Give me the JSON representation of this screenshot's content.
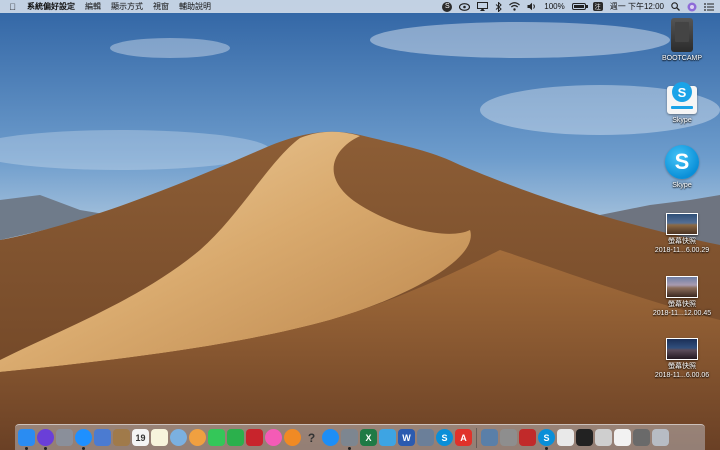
{
  "menubar": {
    "apple_icon": "apple-icon",
    "app_name": "系統偏好設定",
    "menus": [
      "編輯",
      "顯示方式",
      "視窗",
      "輔助說明"
    ],
    "battery_percent": "100%",
    "battery_level": 1.0,
    "ime": "注",
    "clock": "週一 下午12:00"
  },
  "desktop_icons": [
    {
      "label": "BOOTCAMP",
      "icon": "drive-icon"
    },
    {
      "label": "Skype",
      "icon": "skype-installer-icon"
    },
    {
      "label": "Skype",
      "icon": "skype-app-icon"
    },
    {
      "label_line1": "螢幕快照",
      "label_line2": "2018-11...6.00.29",
      "icon": "screenshot-thumbnail-icon"
    },
    {
      "label_line1": "螢幕快照",
      "label_line2": "2018-11...12.00.45",
      "icon": "screenshot-thumbnail-icon"
    },
    {
      "label_line1": "螢幕快照",
      "label_line2": "2018-11...6.00.06",
      "icon": "screenshot-thumbnail-icon"
    }
  ],
  "dock": {
    "apps": [
      {
        "icon": "finder-icon",
        "color": "#2a8cf2",
        "running": true
      },
      {
        "icon": "siri-icon",
        "color": "#6a3fd8",
        "running": true
      },
      {
        "icon": "launchpad-icon",
        "color": "#8a8f9a",
        "running": false
      },
      {
        "icon": "safari-icon",
        "color": "#1e90ff",
        "running": true
      },
      {
        "icon": "preview-icon",
        "color": "#4b7bd1",
        "running": false
      },
      {
        "icon": "notebook-icon",
        "color": "#a07a4a",
        "running": false
      },
      {
        "icon": "calendar-icon",
        "color": "#f4f4f4",
        "glyph": "19",
        "running": false
      },
      {
        "icon": "notes-icon",
        "color": "#f7f4dc",
        "running": false
      },
      {
        "icon": "preview-photos-icon",
        "color": "#7bb0e0",
        "running": false
      },
      {
        "icon": "photos-icon",
        "color": "#f0a040",
        "running": false
      },
      {
        "icon": "messages-icon",
        "color": "#34c759",
        "running": false
      },
      {
        "icon": "facetime-icon",
        "color": "#2bb04c",
        "running": false
      },
      {
        "icon": "photo-booth-icon",
        "color": "#c8242c",
        "running": false
      },
      {
        "icon": "itunes-icon",
        "color": "#f45bb6",
        "running": false
      },
      {
        "icon": "ibooks-icon",
        "color": "#f08a24",
        "running": false
      },
      {
        "icon": "help-icon",
        "color": "transparent",
        "glyph": "?",
        "running": false
      },
      {
        "icon": "app-store-icon",
        "color": "#1e8ef5",
        "running": false
      },
      {
        "icon": "system-preferences-icon",
        "color": "#7d8690",
        "running": true
      },
      {
        "icon": "excel-icon",
        "color": "#1f7a45",
        "glyph": "X",
        "running": false
      },
      {
        "icon": "teams-people-icon",
        "color": "#3da4e3",
        "running": false
      },
      {
        "icon": "word-icon",
        "color": "#2b5bb0",
        "glyph": "W",
        "running": false
      },
      {
        "icon": "tools-icon",
        "color": "#6b7f99",
        "running": false
      },
      {
        "icon": "skype-dock-icon",
        "color": "#0a8fd8",
        "glyph": "S",
        "running": false
      },
      {
        "icon": "acrobat-icon",
        "color": "#e0322a",
        "glyph": "A",
        "running": false
      }
    ],
    "others": [
      {
        "icon": "screenshot-folder-icon",
        "color": "#5a7fa8"
      },
      {
        "icon": "scissors-icon",
        "color": "#8e8e8e"
      },
      {
        "icon": "video-editor-icon",
        "color": "#c12a2a"
      },
      {
        "icon": "skype-running-icon",
        "color": "#0a8fd8",
        "glyph": "S",
        "running": true
      },
      {
        "icon": "documents-folder-icon",
        "color": "#e9e9e9"
      },
      {
        "icon": "downloads-stack-icon",
        "color": "#222222"
      },
      {
        "icon": "images-stack-icon",
        "color": "#cfcfcf"
      },
      {
        "icon": "file-icon",
        "color": "#f2f2f2"
      },
      {
        "icon": "photo-stack-icon",
        "color": "#6a6a6a"
      },
      {
        "icon": "trash-icon",
        "color": "#b7bcc4"
      }
    ]
  }
}
